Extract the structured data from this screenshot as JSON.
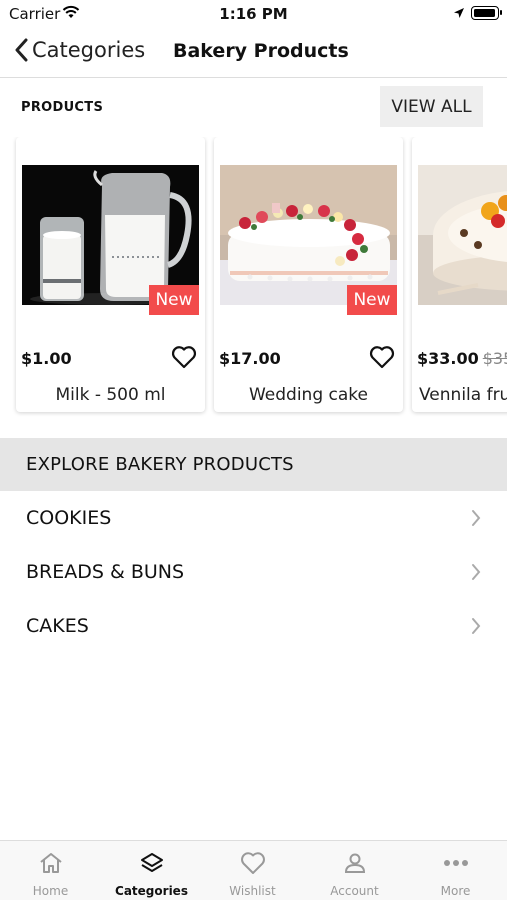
{
  "status_bar": {
    "carrier": "Carrier",
    "time": "1:16 PM"
  },
  "nav": {
    "back_label": "Categories",
    "title": "Bakery Products"
  },
  "products_section": {
    "label": "PRODUCTS",
    "view_all": "VIEW ALL"
  },
  "products": [
    {
      "price": "$1.00",
      "old_price": "",
      "name": "Milk - 500 ml",
      "badge": "New"
    },
    {
      "price": "$17.00",
      "old_price": "",
      "name": "Wedding cake",
      "badge": "New"
    },
    {
      "price": "$33.00",
      "old_price": "$35",
      "name": "Vennila fru",
      "badge": ""
    }
  ],
  "explore": {
    "heading": "EXPLORE BAKERY PRODUCTS",
    "items": [
      {
        "label": "COOKIES"
      },
      {
        "label": "BREADS & BUNS"
      },
      {
        "label": "CAKES"
      }
    ]
  },
  "tabs": [
    {
      "label": "Home",
      "icon": "home-icon",
      "active": false
    },
    {
      "label": "Categories",
      "icon": "layers-icon",
      "active": true
    },
    {
      "label": "Wishlist",
      "icon": "heart-icon",
      "active": false
    },
    {
      "label": "Account",
      "icon": "person-icon",
      "active": false
    },
    {
      "label": "More",
      "icon": "more-dots-icon",
      "active": false
    }
  ],
  "colors": {
    "badge": "#f24b4b",
    "explore_bg": "#e5e5e5",
    "view_all_bg": "#eeeeee"
  }
}
